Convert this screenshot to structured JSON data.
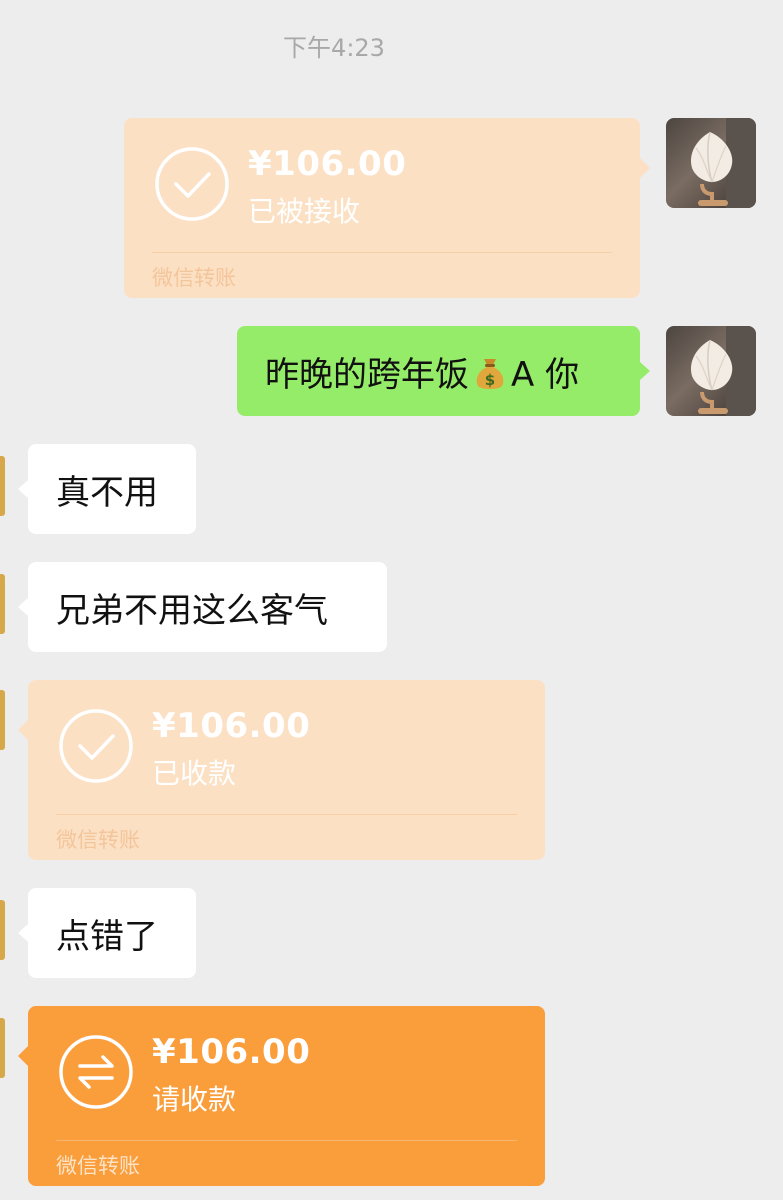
{
  "chat": {
    "timestamp": "下午4:23",
    "messages": [
      {
        "type": "transfer",
        "direction": "out",
        "amount": "¥106.00",
        "status": "已被接收",
        "footer": "微信转账",
        "state": "received"
      },
      {
        "type": "text",
        "direction": "out",
        "text_before": "昨晚的跨年饭",
        "emoji": "money-bag",
        "text_after": "A 你"
      },
      {
        "type": "text",
        "direction": "in",
        "text": "真不用"
      },
      {
        "type": "text",
        "direction": "in",
        "text": "兄弟不用这么客气"
      },
      {
        "type": "transfer",
        "direction": "in",
        "amount": "¥106.00",
        "status": "已收款",
        "footer": "微信转账",
        "state": "received"
      },
      {
        "type": "text",
        "direction": "in",
        "text": "点错了"
      },
      {
        "type": "transfer",
        "direction": "in",
        "amount": "¥106.00",
        "status": "请收款",
        "footer": "微信转账",
        "state": "pending"
      }
    ]
  },
  "colors": {
    "background": "#ededed",
    "outgoing_bubble": "#95ec69",
    "incoming_bubble": "#ffffff",
    "transfer_pending": "#fa9d3b",
    "transfer_done": "#fbe0c4"
  }
}
